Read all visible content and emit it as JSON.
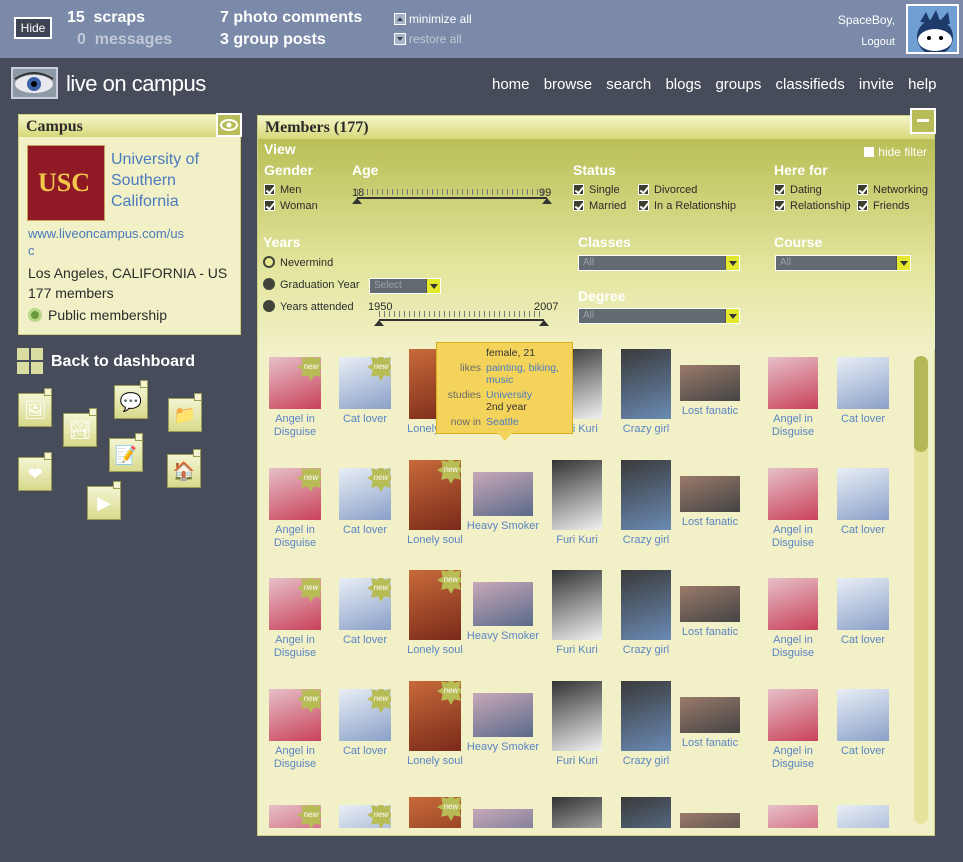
{
  "topbar": {
    "hide_label": "Hide",
    "scraps_count": "15",
    "scraps_label": "scraps",
    "messages_count": "0",
    "messages_label": "messages",
    "photo_comments_count": "7",
    "photo_comments_label": "photo comments",
    "group_posts_count": "3",
    "group_posts_label": "group posts",
    "minimize_all": "minimize all",
    "restore_all": "restore all",
    "username": "SpaceBoy,",
    "logout": "Logout"
  },
  "brand": {
    "name": "live on campus"
  },
  "nav": [
    "home",
    "browse",
    "search",
    "blogs",
    "groups",
    "classifieds",
    "invite",
    "help"
  ],
  "campus": {
    "title": "Campus",
    "logo_text": "USC",
    "university": "University of Southern California",
    "url": "www.liveoncampus.com/usc",
    "location": "Los Angeles, CALIFORNIA - US",
    "members": "177 members",
    "membership": "Public membership"
  },
  "back_label": "Back to dashboard",
  "members": {
    "title": "Members (177)",
    "view": "View",
    "hide_filter": "hide filter",
    "gender": {
      "label": "Gender",
      "options": [
        "Men",
        "Woman"
      ]
    },
    "age": {
      "label": "Age",
      "min": "18",
      "max": "99"
    },
    "status": {
      "label": "Status",
      "options": [
        "Single",
        "Divorced",
        "Married",
        "In a Relationship"
      ]
    },
    "here_for": {
      "label": "Here for",
      "options": [
        "Dating",
        "Networking",
        "Relationship",
        "Friends"
      ]
    },
    "years": {
      "label": "Years",
      "options": [
        "Nevermind",
        "Graduation Year",
        "Years attended"
      ],
      "select_placeholder": "Select",
      "min": "1950",
      "max": "2007"
    },
    "classes": {
      "label": "Classes",
      "value": "All"
    },
    "course": {
      "label": "Course",
      "value": "All"
    },
    "degree": {
      "label": "Degree",
      "value": "All"
    },
    "new_badge": "new",
    "row_names": [
      "Angel in Disguise",
      "Cat lover",
      "Lonely soul",
      "Heavy Smoker",
      "Furi Kuri",
      "Crazy girl",
      "Lost fanatic",
      "Angel in Disguise",
      "Cat lover"
    ]
  },
  "tooltip": {
    "gender_age": "female, 21",
    "likes_k": "likes",
    "likes_v": "painting, biking, music",
    "studies_k": "studies",
    "studies_v1": "University",
    "studies_v2": "2nd year",
    "now_k": "now in",
    "now_v": "Seattle"
  }
}
